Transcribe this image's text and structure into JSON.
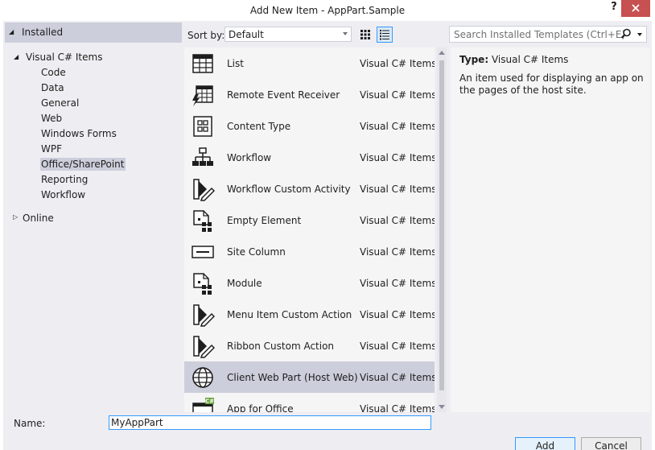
{
  "window": {
    "title": "Add New Item - AppPart.Sample",
    "help": "?"
  },
  "tree": {
    "installed": "Installed",
    "visual_csharp": "Visual C# Items",
    "children": [
      "Code",
      "Data",
      "General",
      "Web",
      "Windows Forms",
      "WPF",
      "Office/SharePoint",
      "Reporting",
      "Workflow"
    ],
    "selected": "Office/SharePoint",
    "online": "Online"
  },
  "toolbar": {
    "sort_label": "Sort by:",
    "sort_value": "Default",
    "search_placeholder": "Search Installed Templates (Ctrl+E)"
  },
  "templates": [
    {
      "name": "List",
      "category": "Visual C# Items",
      "icon": "list-icon"
    },
    {
      "name": "Remote Event Receiver",
      "category": "Visual C# Items",
      "icon": "remote-event-receiver-icon"
    },
    {
      "name": "Content Type",
      "category": "Visual C# Items",
      "icon": "content-type-icon"
    },
    {
      "name": "Workflow",
      "category": "Visual C# Items",
      "icon": "workflow-icon"
    },
    {
      "name": "Workflow Custom Activity",
      "category": "Visual C# Items",
      "icon": "custom-activity-icon"
    },
    {
      "name": "Empty Element",
      "category": "Visual C# Items",
      "icon": "empty-element-icon"
    },
    {
      "name": "Site Column",
      "category": "Visual C# Items",
      "icon": "site-column-icon"
    },
    {
      "name": "Module",
      "category": "Visual C# Items",
      "icon": "module-icon"
    },
    {
      "name": "Menu Item Custom Action",
      "category": "Visual C# Items",
      "icon": "custom-action-icon"
    },
    {
      "name": "Ribbon Custom Action",
      "category": "Visual C# Items",
      "icon": "custom-action-icon"
    },
    {
      "name": "Client Web Part (Host Web)",
      "category": "Visual C# Items",
      "icon": "globe-icon"
    },
    {
      "name": "App for Office",
      "category": "Visual C# Items",
      "icon": "app-for-office-icon"
    }
  ],
  "selected_template": "Client Web Part (Host Web)",
  "details": {
    "type_label": "Type:",
    "type_value": "Visual C# Items",
    "description": "An item used for displaying an app on the pages of the host site."
  },
  "footer": {
    "name_label": "Name:",
    "name_value": "MyAppPart",
    "add_label": "Add",
    "cancel_label": "Cancel"
  },
  "colors": {
    "dialog_bg": "#eeeef2",
    "selection": "#cccedb",
    "accent": "#3399ff",
    "close": "#c75050"
  }
}
